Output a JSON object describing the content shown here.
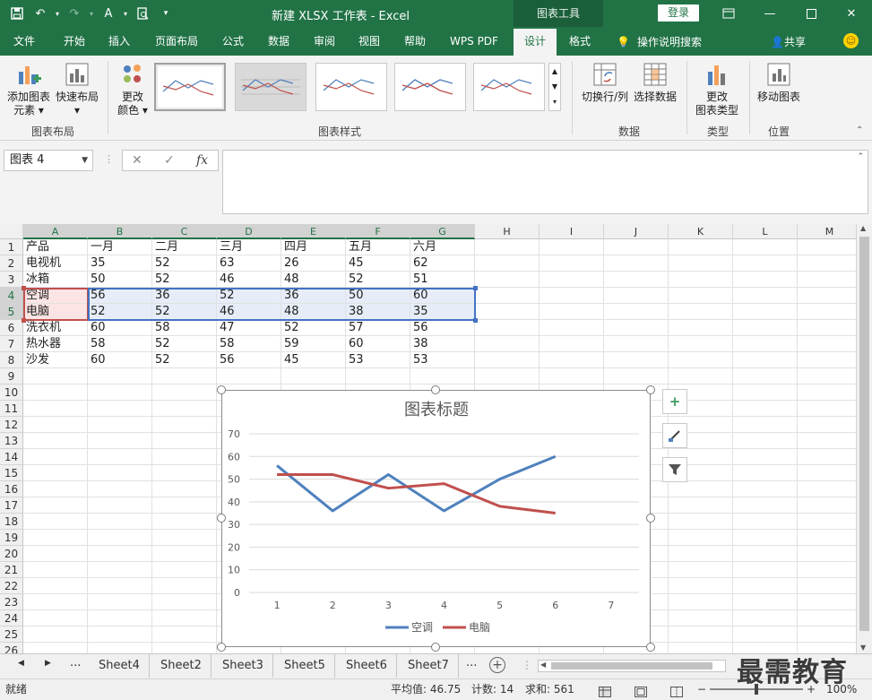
{
  "window": {
    "title": "新建 XLSX 工作表  -  Excel",
    "context_tab": "图表工具",
    "login_label": "登录"
  },
  "tabs": [
    {
      "label": "文件"
    },
    {
      "label": "开始"
    },
    {
      "label": "插入"
    },
    {
      "label": "页面布局"
    },
    {
      "label": "公式"
    },
    {
      "label": "数据"
    },
    {
      "label": "审阅"
    },
    {
      "label": "视图"
    },
    {
      "label": "帮助"
    },
    {
      "label": "WPS PDF"
    },
    {
      "label": "设计",
      "active": true
    },
    {
      "label": "格式"
    }
  ],
  "tell_me": "操作说明搜索",
  "share": "共享",
  "ribbon": {
    "layout_group": {
      "label": "图表布局",
      "add_element_1": "添加图表",
      "add_element_2": "元素",
      "quick_layout": "快速布局"
    },
    "styles_group": {
      "label": "图表样式",
      "change_colors_1": "更改",
      "change_colors_2": "颜色"
    },
    "data_group": {
      "label": "数据",
      "switch_row_col": "切换行/列",
      "select_data": "选择数据"
    },
    "type_group": {
      "label": "类型",
      "change_type_1": "更改",
      "change_type_2": "图表类型"
    },
    "location_group": {
      "label": "位置",
      "move_chart": "移动图表"
    }
  },
  "formula_bar": {
    "name_box": "图表 4",
    "fx_label": "fx"
  },
  "columns": [
    "A",
    "B",
    "C",
    "D",
    "E",
    "F",
    "G",
    "H",
    "I",
    "J",
    "K",
    "L",
    "M"
  ],
  "rows": [
    "1",
    "2",
    "3",
    "4",
    "5",
    "6",
    "7",
    "8",
    "9",
    "10",
    "11",
    "12",
    "13",
    "14",
    "15",
    "16",
    "17",
    "18",
    "19",
    "20",
    "21",
    "22",
    "23",
    "24",
    "25",
    "26"
  ],
  "sheet": [
    [
      "产品",
      "一月",
      "二月",
      "三月",
      "四月",
      "五月",
      "六月"
    ],
    [
      "电视机",
      "35",
      "52",
      "63",
      "26",
      "45",
      "62"
    ],
    [
      "冰箱",
      "50",
      "52",
      "46",
      "48",
      "52",
      "51"
    ],
    [
      "空调",
      "56",
      "36",
      "52",
      "36",
      "50",
      "60"
    ],
    [
      "电脑",
      "52",
      "52",
      "46",
      "48",
      "38",
      "35"
    ],
    [
      "洗衣机",
      "60",
      "58",
      "47",
      "52",
      "57",
      "56"
    ],
    [
      "热水器",
      "58",
      "52",
      "58",
      "59",
      "60",
      "38"
    ],
    [
      "沙发",
      "60",
      "52",
      "56",
      "45",
      "53",
      "53"
    ]
  ],
  "chart_data": {
    "type": "line",
    "title": "图表标题",
    "x": [
      1,
      2,
      3,
      4,
      5,
      6,
      7
    ],
    "x_ticks": [
      "1",
      "2",
      "3",
      "4",
      "5",
      "6",
      "7"
    ],
    "y_ticks": [
      "0",
      "10",
      "20",
      "30",
      "40",
      "50",
      "60",
      "70"
    ],
    "ylim": [
      0,
      70
    ],
    "grid": true,
    "legend": "bottom",
    "series": [
      {
        "name": "空调",
        "color": "#4f81bd",
        "values": [
          56,
          36,
          52,
          36,
          50,
          60
        ]
      },
      {
        "name": "电脑",
        "color": "#c0504d",
        "values": [
          52,
          52,
          46,
          48,
          38,
          35
        ]
      }
    ]
  },
  "chart_buttons": {
    "elements_icon": "plus-icon",
    "styles_icon": "brush-icon",
    "filter_icon": "filter-icon"
  },
  "sheet_tabs": [
    "Sheet4",
    "Sheet2",
    "Sheet3",
    "Sheet5",
    "Sheet6",
    "Sheet7"
  ],
  "status": {
    "ready": "就绪",
    "average": "平均值: 46.75",
    "count": "计数: 14",
    "sum": "求和: 561",
    "zoom": "100%"
  },
  "watermark": "最需教育",
  "colors": {
    "brand": "#217346",
    "selection_blue": "#4472c4",
    "selection_red": "#c0504d"
  }
}
